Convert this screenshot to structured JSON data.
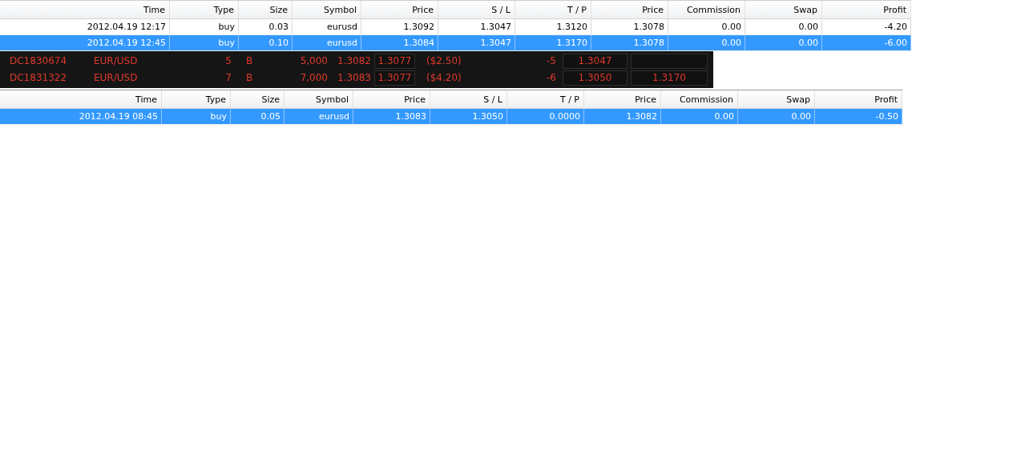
{
  "top_table": {
    "columns": [
      "Time",
      "Type",
      "Size",
      "Symbol",
      "Price",
      "S / L",
      "T / P",
      "Price",
      "Commission",
      "Swap",
      "Profit"
    ],
    "rows": [
      {
        "selected": false,
        "cells": [
          "2012.04.19 12:17",
          "buy",
          "0.03",
          "eurusd",
          "1.3092",
          "1.3047",
          "1.3120",
          "1.3078",
          "0.00",
          "0.00",
          "-4.20"
        ]
      },
      {
        "selected": true,
        "cells": [
          "2012.04.19 12:45",
          "buy",
          "0.10",
          "eurusd",
          "1.3084",
          "1.3047",
          "1.3170",
          "1.3078",
          "0.00",
          "0.00",
          "-6.00"
        ]
      }
    ]
  },
  "dealer_table": {
    "rows": [
      {
        "cells": [
          {
            "kind": "plain",
            "text": "DC1830674"
          },
          {
            "kind": "plain",
            "text": "EUR/USD"
          },
          {
            "kind": "plain",
            "text": "5"
          },
          {
            "kind": "plain",
            "text": "B"
          },
          {
            "kind": "plain",
            "text": "5,000"
          },
          {
            "kind": "plain",
            "text": "1.3082"
          },
          {
            "kind": "boxed",
            "text": "1.3077"
          },
          {
            "kind": "plain",
            "text": "($2.50)"
          },
          {
            "kind": "plain",
            "text": "-5"
          },
          {
            "kind": "boxed",
            "text": "1.3047"
          },
          {
            "kind": "boxed"
          }
        ]
      },
      {
        "cells": [
          {
            "kind": "plain",
            "text": "DC1831322"
          },
          {
            "kind": "plain",
            "text": "EUR/USD"
          },
          {
            "kind": "plain",
            "text": "7"
          },
          {
            "kind": "plain",
            "text": "B"
          },
          {
            "kind": "plain",
            "text": "7,000"
          },
          {
            "kind": "plain",
            "text": "1.3083"
          },
          {
            "kind": "boxed",
            "text": "1.3077"
          },
          {
            "kind": "plain",
            "text": "($4.20)"
          },
          {
            "kind": "plain",
            "text": "-6"
          },
          {
            "kind": "boxed",
            "text": "1.3050"
          },
          {
            "kind": "boxed",
            "text": "1.3170"
          }
        ]
      }
    ]
  },
  "bottom_table": {
    "columns": [
      "Time",
      "Type",
      "Size",
      "Symbol",
      "Price",
      "S / L",
      "T / P",
      "Price",
      "Commission",
      "Swap",
      "Profit"
    ],
    "rows": [
      {
        "selected": true,
        "cells": [
          "2012.04.19 08:45",
          "buy",
          "0.05",
          "eurusd",
          "1.3083",
          "1.3050",
          "0.0000",
          "1.3082",
          "0.00",
          "0.00",
          "-0.50"
        ]
      }
    ]
  }
}
